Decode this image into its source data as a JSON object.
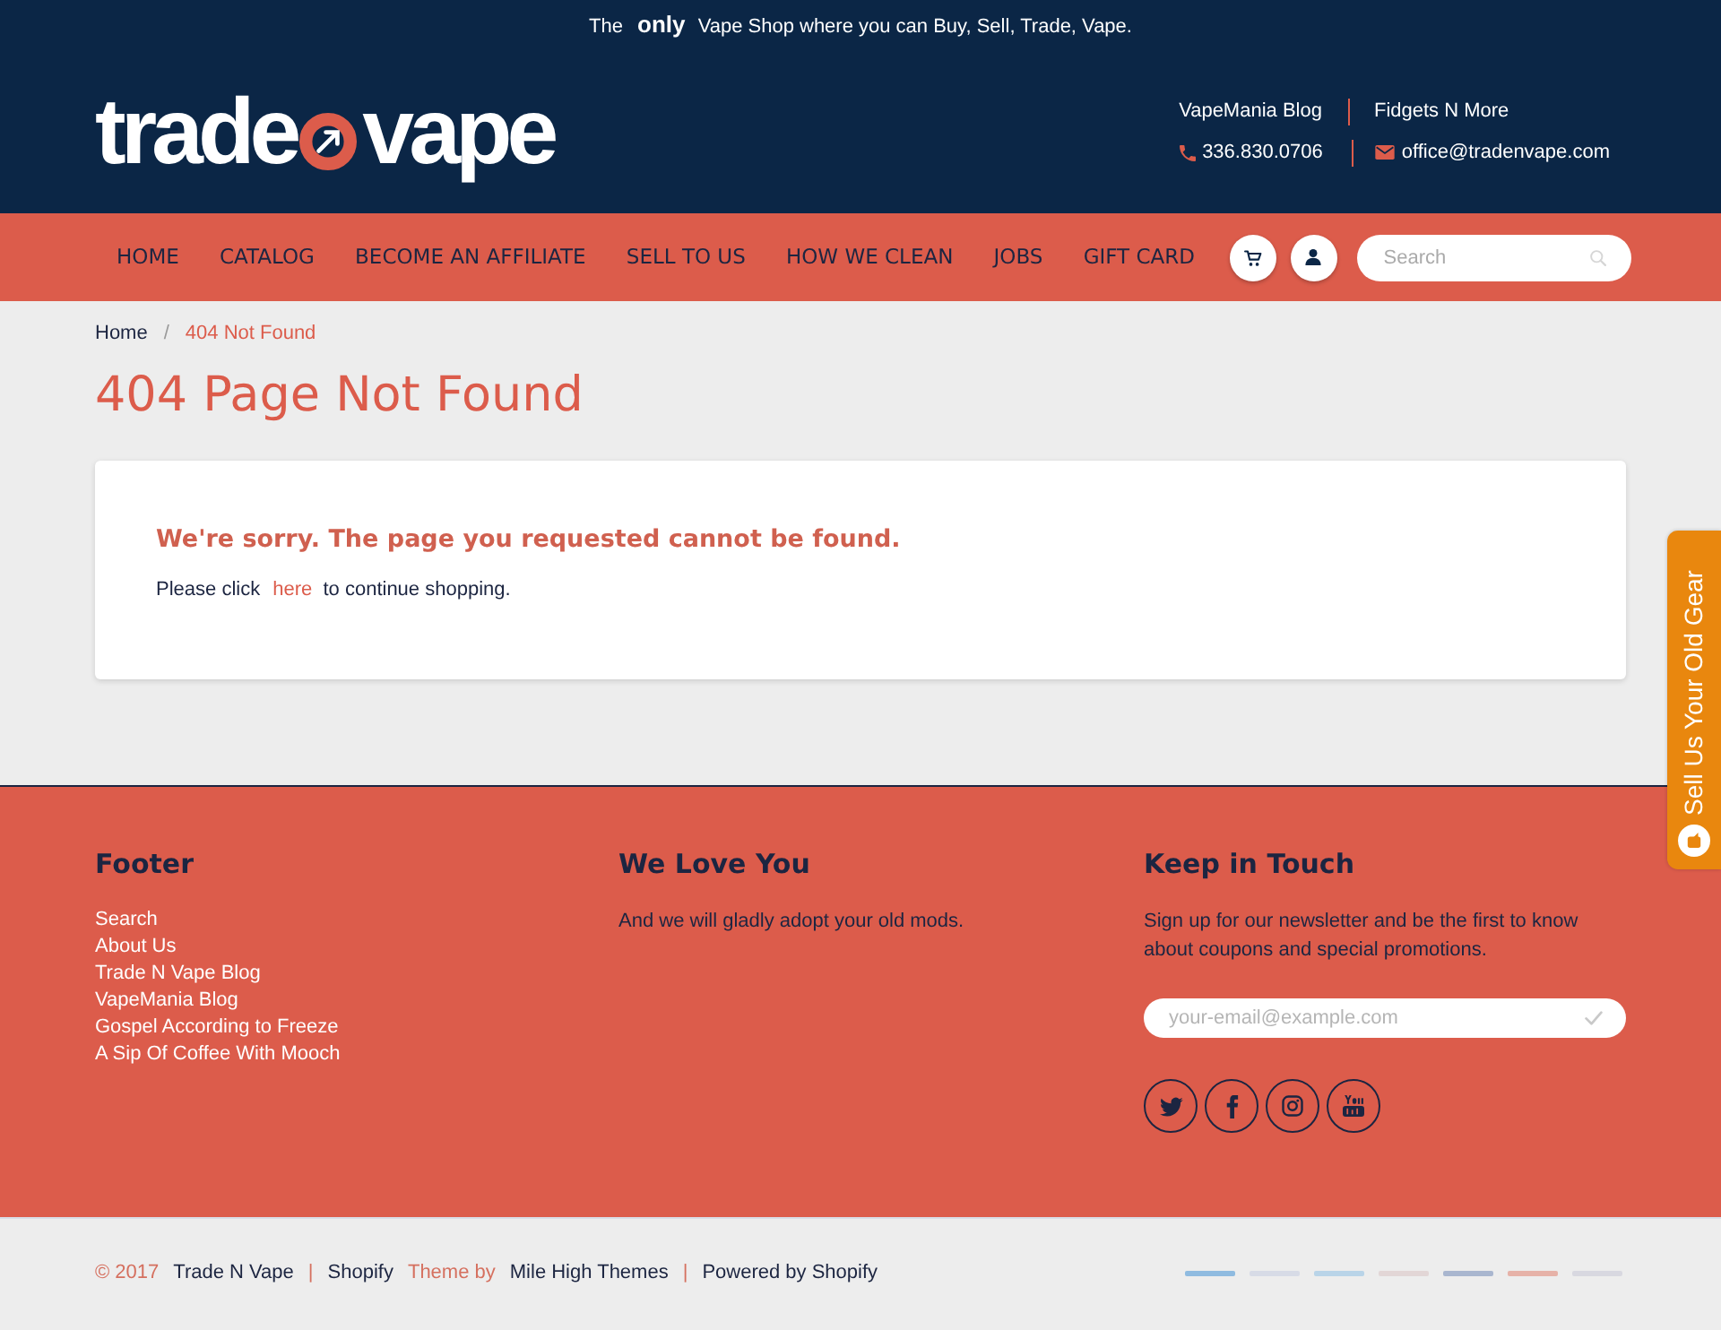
{
  "announcement": {
    "text": "The **only** Vape Shop where you can Buy, Sell, Trade, Vape."
  },
  "logo": {
    "left": "trade",
    "right": "vape"
  },
  "header_links": [
    {
      "label": "VapeMania Blog"
    },
    {
      "label": "Fidgets N More"
    }
  ],
  "contact": [
    {
      "kind": "phone",
      "text": "336.830.0706"
    },
    {
      "kind": "email",
      "text": "office@tradenvape.com"
    }
  ],
  "nav": {
    "items": [
      "HOME",
      "CATALOG",
      "BECOME AN AFFILIATE",
      "SELL TO US",
      "HOW WE CLEAN",
      "JOBS",
      "GIFT CARD"
    ],
    "icon_buttons": [
      {
        "kind": "cart"
      },
      {
        "kind": "account"
      }
    ],
    "search": {
      "placeholder": "Search"
    }
  },
  "breadcrumb": {
    "separator": "/",
    "items": [
      {
        "label": "Home",
        "current": false
      },
      {
        "label": "404 Not Found",
        "current": true
      }
    ]
  },
  "page_title": "404 Page Not Found",
  "notice": {
    "heading": "We're sorry. The page you requested cannot be found.",
    "text_before": "Please click",
    "link": "here",
    "text_after": "to continue shopping."
  },
  "footer": {
    "columns": [
      {
        "kind": "links",
        "title": "Footer",
        "links": [
          "Search",
          "About Us",
          "Trade N Vape Blog",
          "VapeMania Blog",
          "Gospel According to Freeze",
          "A Sip Of Coffee With Mooch"
        ]
      },
      {
        "kind": "text",
        "title": "We Love You",
        "text": "And we will gladly adopt your old mods."
      },
      {
        "kind": "newsletter",
        "title": "Keep in Touch",
        "text": "Sign up for our newsletter and be the first to know about coupons and special promotions.",
        "email_placeholder": "your-email@example.com",
        "social": [
          {
            "kind": "twitter"
          },
          {
            "kind": "facebook"
          },
          {
            "kind": "instagram"
          },
          {
            "kind": "youtube"
          }
        ]
      }
    ]
  },
  "bottom_bar": {
    "segments": [
      {
        "kind": "note",
        "text": "© 2017"
      },
      {
        "kind": "link",
        "text": "Trade N Vape"
      },
      {
        "kind": "separator",
        "text": "|"
      },
      {
        "kind": "text",
        "text": "Shopify"
      },
      {
        "kind": "note",
        "text": "Theme by"
      },
      {
        "kind": "link",
        "text": "Mile High Themes"
      },
      {
        "kind": "separator",
        "text": "|"
      },
      {
        "kind": "link",
        "text": "Powered by Shopify"
      }
    ]
  },
  "side_tab": {
    "label": "Sell Us Your Old Gear"
  }
}
